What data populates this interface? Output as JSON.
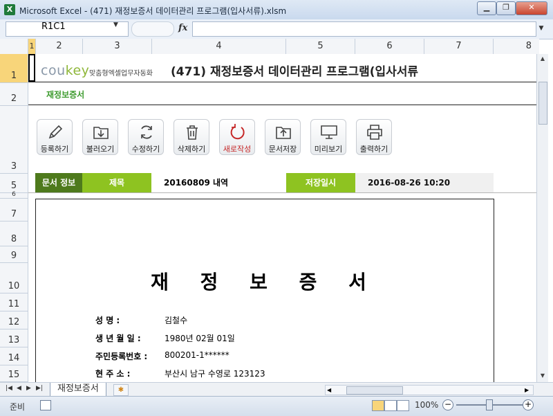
{
  "window": {
    "app_icon": "X",
    "title": "Microsoft Excel - (471) 재정보증서 데이터관리 프로그램(입사서류).xlsm",
    "buttons": [
      "minimize-icon",
      "restore-icon",
      "close-icon"
    ]
  },
  "formula_bar": {
    "name_box": "R1C1",
    "fx": "fx",
    "formula": ""
  },
  "columns": [
    "1",
    "2",
    "3",
    "4",
    "5",
    "6",
    "7",
    "8"
  ],
  "rows": [
    "1",
    "2",
    "3",
    "5",
    "6",
    "7",
    "8",
    "9",
    "10",
    "11",
    "12",
    "13",
    "14",
    "15"
  ],
  "header": {
    "brand_cou": "cou",
    "brand_key": "key",
    "brand_sub": "맞춤형엑셀업무자동화",
    "heading": "(471) 재정보증서 데이터관리 프로그램(입사서류"
  },
  "section_label": "재정보증서",
  "toolbar": [
    {
      "label": "등록하기",
      "icon": "pencil-icon"
    },
    {
      "label": "불러오기",
      "icon": "load-icon"
    },
    {
      "label": "수정하기",
      "icon": "refresh-icon"
    },
    {
      "label": "삭제하기",
      "icon": "trash-icon"
    },
    {
      "label": "새로작성",
      "icon": "new-doc-icon"
    },
    {
      "label": "문서저장",
      "icon": "save-folder-icon"
    },
    {
      "label": "미리보기",
      "icon": "monitor-icon"
    },
    {
      "label": "출력하기",
      "icon": "printer-icon"
    }
  ],
  "info": {
    "doc_info_label": "문서 정보",
    "title_label": "제목",
    "title_value": "20160809 내역",
    "saved_label": "저장일시",
    "saved_value": "2016-08-26 10:20"
  },
  "document": {
    "title": "재 정 보 증 서",
    "fields": [
      {
        "label": "성          명 :",
        "value": "김철수"
      },
      {
        "label": "생 년 월 일 :",
        "value": "1980년 02월 01일"
      },
      {
        "label": "주민등록번호 :",
        "value": "800201-1******"
      },
      {
        "label": "현    주    소 :",
        "value": "부산시 남구 수영로 123123"
      }
    ]
  },
  "tabs": {
    "sheet_tab": "재정보증서"
  },
  "status": {
    "ready": "준비",
    "zoom": "100%"
  },
  "colors": {
    "green_dark": "#4e7a1c",
    "green": "#8ec321",
    "section": "#3d9b2e",
    "selection": "#f8d57a"
  }
}
